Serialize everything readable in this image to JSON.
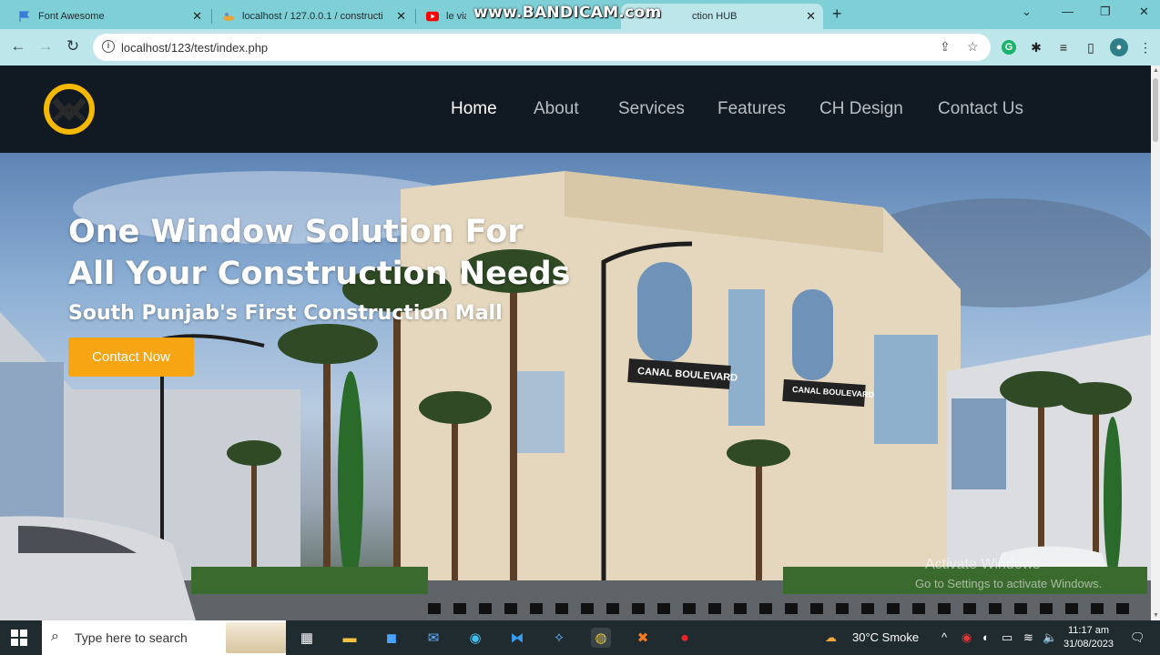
{
  "browser": {
    "tabs": [
      {
        "title": "Font Awesome",
        "icon": "flag-icon",
        "active": false
      },
      {
        "title": "localhost / 127.0.0.1 / constructi",
        "icon": "phpmyadmin-icon",
        "active": false
      },
      {
        "title": "le via",
        "icon": "youtube-icon",
        "active": false
      },
      {
        "title": "ction HUB",
        "icon": "page-icon",
        "active": true
      }
    ],
    "watermark": "www.BANDICAM.com",
    "url": "localhost/123/test/index.php"
  },
  "site": {
    "nav": [
      {
        "label": "Home",
        "active": true
      },
      {
        "label": "About",
        "active": false
      },
      {
        "label": "Services",
        "active": false
      },
      {
        "label": "Features",
        "active": false
      },
      {
        "label": "CH Design",
        "active": false
      },
      {
        "label": "Contact Us",
        "active": false
      }
    ],
    "hero": {
      "title": "One Window Solution For All Your Construction Needs",
      "subtitle": "South Punjab's First Construction Mall",
      "cta": "Contact Now",
      "signs": [
        "CANAL BOULEVARD",
        "CANAL BOULEVARD"
      ]
    },
    "activation": {
      "line1": "Activate Windows",
      "line2": "Go to Settings to activate Windows."
    }
  },
  "colors": {
    "header_bg": "#111a23",
    "accent": "#f7a513",
    "logo_yellow": "#f5b800",
    "tab_bar": "#7fcfd6"
  },
  "taskbar": {
    "search_placeholder": "Type here to search",
    "weather": "30°C  Smoke",
    "time": "11:17 am",
    "date": "31/08/2023"
  }
}
